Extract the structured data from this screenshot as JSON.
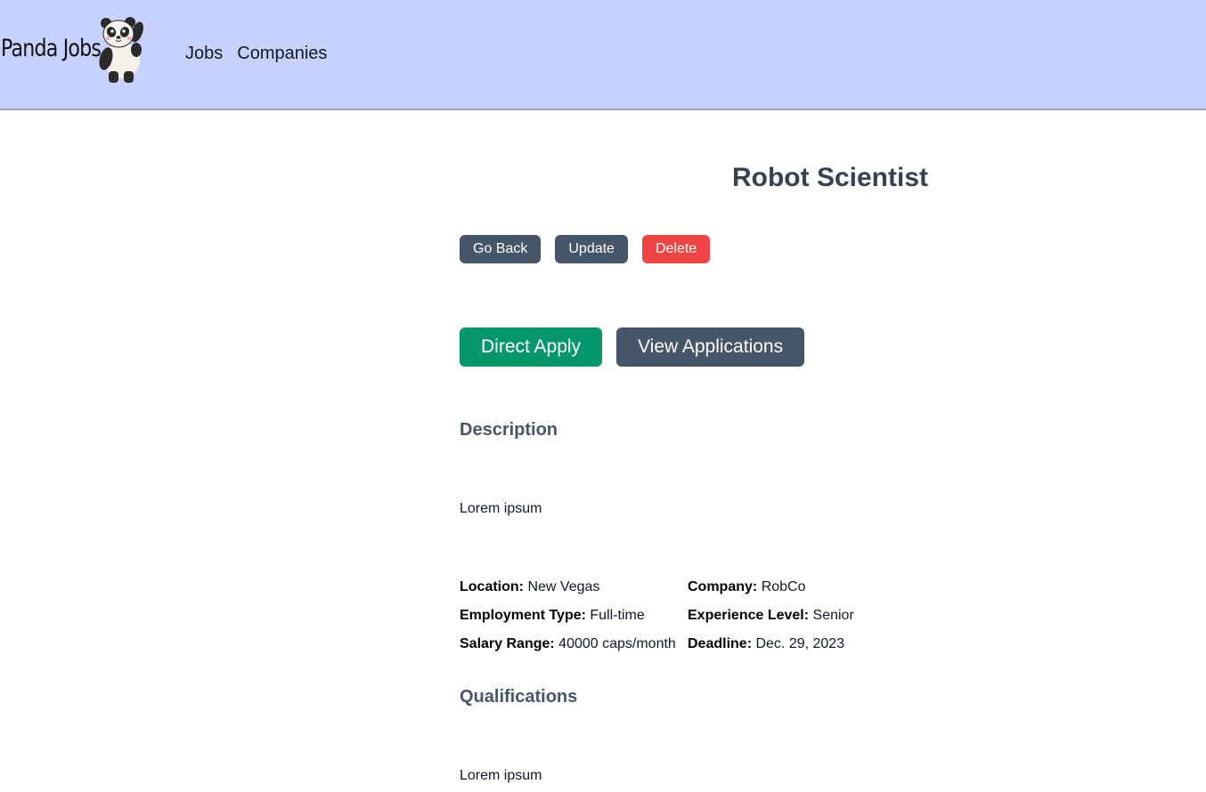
{
  "header": {
    "brand": "Panda Jobs",
    "nav": [
      {
        "label": "Jobs"
      },
      {
        "label": "Companies"
      }
    ]
  },
  "job": {
    "title": "Robot Scientist",
    "actions": {
      "go_back": "Go Back",
      "update": "Update",
      "delete": "Delete"
    },
    "primary_actions": {
      "apply": "Direct Apply",
      "view_applications": "View Applications"
    },
    "description_heading": "Description",
    "description": "Lorem ipsum",
    "details": {
      "location": {
        "label": "Location:",
        "value": "New Vegas"
      },
      "company": {
        "label": "Company:",
        "value": "RobCo"
      },
      "employment_type": {
        "label": "Employment Type:",
        "value": "Full-time"
      },
      "experience_level": {
        "label": "Experience Level:",
        "value": "Senior"
      },
      "salary_range": {
        "label": "Salary Range:",
        "value": "40000 caps/month"
      },
      "deadline": {
        "label": "Deadline:",
        "value": "Dec. 29, 2023"
      }
    },
    "qualifications_heading": "Qualifications",
    "qualifications": "Lorem ipsum"
  },
  "colors": {
    "navbar_bg": "#c7d2fe",
    "button_dark": "#475569",
    "button_delete": "#ef4444",
    "button_apply": "#059669",
    "heading": "#374151"
  }
}
